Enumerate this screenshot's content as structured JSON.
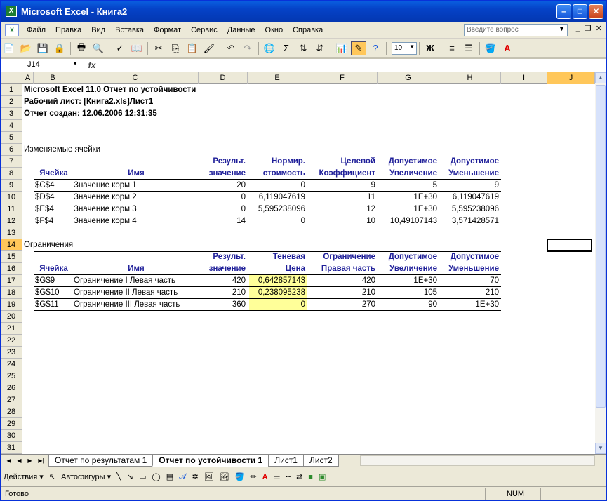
{
  "window": {
    "title": "Microsoft Excel - Книга2",
    "app_icon": "excel-icon"
  },
  "menu": {
    "items": [
      "Файл",
      "Правка",
      "Вид",
      "Вставка",
      "Формат",
      "Сервис",
      "Данные",
      "Окно",
      "Справка"
    ],
    "ask_placeholder": "Введите вопрос"
  },
  "toolbar": {
    "font_size": "10",
    "bold": "Ж",
    "sigma": "Σ"
  },
  "formula": {
    "cell_ref": "J14",
    "fx": "fx",
    "content": ""
  },
  "columns": [
    "A",
    "B",
    "C",
    "D",
    "E",
    "F",
    "G",
    "H",
    "I",
    "J"
  ],
  "rows": [
    "1",
    "2",
    "3",
    "4",
    "5",
    "6",
    "7",
    "8",
    "9",
    "10",
    "11",
    "12",
    "13",
    "14",
    "15",
    "16",
    "17",
    "18",
    "19",
    "20",
    "21",
    "22",
    "23",
    "24",
    "25",
    "26",
    "27",
    "28",
    "29",
    "30",
    "31"
  ],
  "report": {
    "line1": "Microsoft Excel 11.0 Отчет по устойчивости",
    "line2": "Рабочий лист: [Книга2.xls]Лист1",
    "line3": "Отчет создан: 12.06.2006 12:31:35"
  },
  "variables": {
    "section_title": "Изменяемые ячейки",
    "headers_top": [
      "",
      "",
      "Результ.",
      "Нормир.",
      "Целевой",
      "Допустимое",
      "Допустимое"
    ],
    "headers_bottom": [
      "Ячейка",
      "Имя",
      "значение",
      "стоимость",
      "Коэффициент",
      "Увеличение",
      "Уменьшение"
    ],
    "rows": [
      [
        "$C$4",
        "Значение корм 1",
        "20",
        "0",
        "9",
        "5",
        "9"
      ],
      [
        "$D$4",
        "Значение корм 2",
        "0",
        "6,119047619",
        "11",
        "1E+30",
        "6,119047619"
      ],
      [
        "$E$4",
        "Значение корм 3",
        "0",
        "5,595238096",
        "12",
        "1E+30",
        "5,595238096"
      ],
      [
        "$F$4",
        "Значение корм 4",
        "14",
        "0",
        "10",
        "10,49107143",
        "3,571428571"
      ]
    ]
  },
  "constraints": {
    "section_title": "Ограничения",
    "headers_top": [
      "",
      "",
      "Результ.",
      "Теневая",
      "Ограничение",
      "Допустимое",
      "Допустимое"
    ],
    "headers_bottom": [
      "Ячейка",
      "Имя",
      "значение",
      "Цена",
      "Правая часть",
      "Увеличение",
      "Уменьшение"
    ],
    "rows": [
      [
        "$G$9",
        "Ограничение I Левая часть",
        "420",
        "0,642857143",
        "420",
        "1E+30",
        "70"
      ],
      [
        "$G$10",
        "Ограничение II Левая часть",
        "210",
        "0,238095238",
        "210",
        "105",
        "210"
      ],
      [
        "$G$11",
        "Ограничение III Левая часть",
        "360",
        "0",
        "270",
        "90",
        "1E+30"
      ]
    ]
  },
  "tabs": [
    "Отчет по результатам 1",
    "Отчет по устойчивости 1",
    "Лист1",
    "Лист2"
  ],
  "drawbar": {
    "actions": "Действия ▾",
    "autoshapes": "Автофигуры ▾"
  },
  "status": {
    "ready": "Готово",
    "num": "NUM"
  },
  "colors": {
    "selected_header": "#ffc75a",
    "highlight": "#ffff99",
    "header_text": "#1f1f99"
  }
}
